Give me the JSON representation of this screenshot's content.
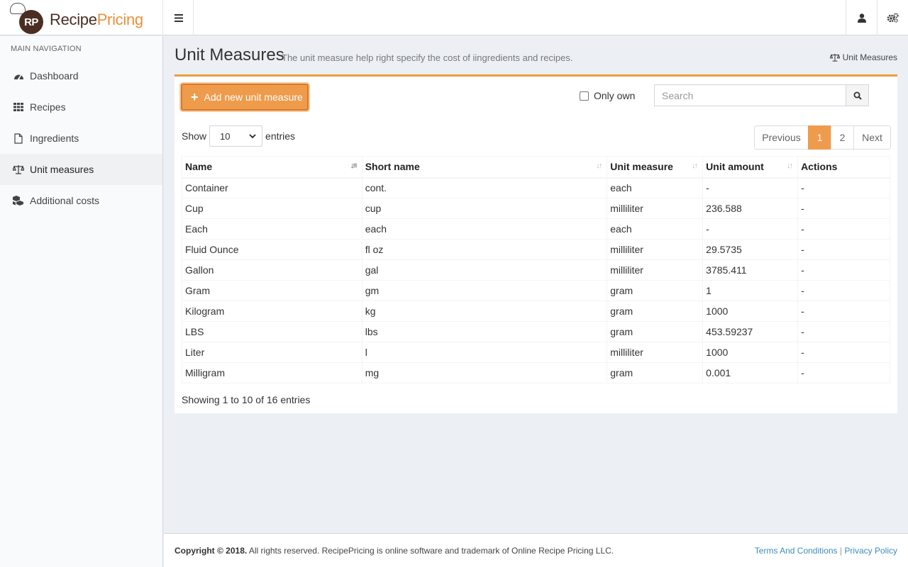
{
  "brand": {
    "initials": "RP",
    "name_part1": "Recipe",
    "name_part2": "Pricing"
  },
  "sidebar": {
    "header": "MAIN NAVIGATION",
    "items": [
      {
        "label": "Dashboard",
        "icon": "dashboard-icon"
      },
      {
        "label": "Recipes",
        "icon": "grid-icon"
      },
      {
        "label": "Ingredients",
        "icon": "file-icon"
      },
      {
        "label": "Unit measures",
        "icon": "balance-scale-icon",
        "active": true
      },
      {
        "label": "Additional costs",
        "icon": "cubes-icon"
      }
    ]
  },
  "page": {
    "title": "Unit Measures",
    "subtitle": "The unit measure help right specify the cost of iingredients and recipes.",
    "breadcrumb": "Unit Measures"
  },
  "toolbar": {
    "add_label": "Add new unit measure",
    "only_own_label": "Only own",
    "only_own_checked": false,
    "search_placeholder": "Search"
  },
  "table_controls": {
    "show_label": "Show",
    "page_size": "10",
    "entries_label": "entries",
    "previous": "Previous",
    "pages": [
      "1",
      "2"
    ],
    "current_page": "1",
    "next": "Next",
    "info": "Showing 1 to 10 of 16 entries"
  },
  "table": {
    "columns": [
      "Name",
      "Short name",
      "Unit measure",
      "Unit amount",
      "Actions"
    ],
    "rows": [
      [
        "Container",
        "cont.",
        "each",
        "-",
        "-"
      ],
      [
        "Cup",
        "cup",
        "milliliter",
        "236.588",
        "-"
      ],
      [
        "Each",
        "each",
        "each",
        "-",
        "-"
      ],
      [
        "Fluid Ounce",
        "fl oz",
        "milliliter",
        "29.5735",
        "-"
      ],
      [
        "Gallon",
        "gal",
        "milliliter",
        "3785.411",
        "-"
      ],
      [
        "Gram",
        "gm",
        "gram",
        "1",
        "-"
      ],
      [
        "Kilogram",
        "kg",
        "gram",
        "1000",
        "-"
      ],
      [
        "LBS",
        "lbs",
        "gram",
        "453.59237",
        "-"
      ],
      [
        "Liter",
        "l",
        "milliliter",
        "1000",
        "-"
      ],
      [
        "Milligram",
        "mg",
        "gram",
        "0.001",
        "-"
      ]
    ]
  },
  "footer": {
    "copyright": "Copyright © 2018.",
    "text": " All rights reserved. RecipePricing is online software and trademark of Online Recipe Pricing LLC.",
    "terms": "Terms And Conditions",
    "separator": "|",
    "privacy": "Privacy Policy"
  },
  "colors": {
    "accent": "#ef9b4c",
    "brand_dark": "#4a2e22",
    "link": "#3c8dbc"
  }
}
